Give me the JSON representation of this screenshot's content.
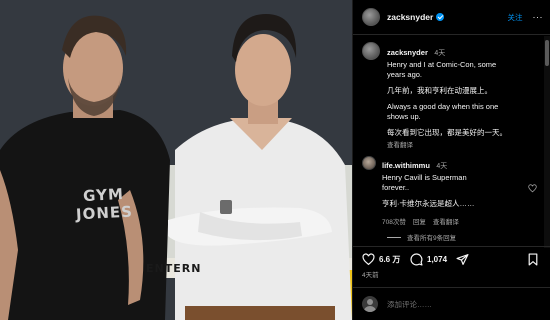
{
  "photo": {
    "shirt_print": "GYM JONES",
    "banner_text": "ENTERN"
  },
  "header": {
    "username": "zacksnyder",
    "follow_label": "关注",
    "more_label": "···"
  },
  "caption": {
    "username": "zacksnyder",
    "time": "4天",
    "lines": [
      "Henry and I at Comic-Con, some",
      "years ago.",
      "几年前，我和亨利在动漫展上。",
      "Always a good day when this one",
      "shows up.",
      "每次看到它出现，都是美好的一天。",
      "查看翻译"
    ]
  },
  "comment": {
    "username": "life.withimmu",
    "time": "4天",
    "lines": [
      "Henry Cavill is Superman",
      "forever..",
      "亨利·卡维尔永远是超人……"
    ],
    "likes": "708次赞",
    "reply_label": "回复",
    "translate_label": "查看翻译",
    "view_replies": "查看所有9条回复"
  },
  "actions": {
    "like_count": "6.6 万",
    "comment_count": "1,074",
    "posted_time": "4天前"
  },
  "add_comment": {
    "placeholder": "添加评论……"
  },
  "colors": {
    "link_blue": "#0095f6",
    "muted_text": "#a8a8a8",
    "background": "#000000"
  }
}
